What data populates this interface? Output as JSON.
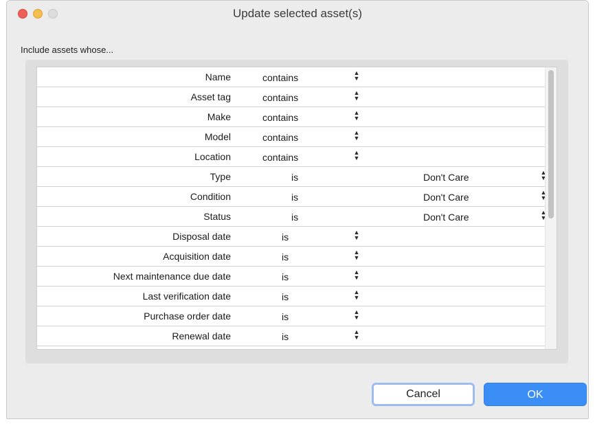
{
  "window": {
    "title": "Update selected asset(s)",
    "subtitle": "Include assets whose..."
  },
  "rows": [
    {
      "label": "Name",
      "op": "contains"
    },
    {
      "label": "Asset tag",
      "op": "contains"
    },
    {
      "label": "Make",
      "op": "contains"
    },
    {
      "label": "Model",
      "op": "contains"
    },
    {
      "label": "Location",
      "op": "contains"
    },
    {
      "label": "Type",
      "op": "is",
      "value": "Don't Care"
    },
    {
      "label": "Condition",
      "op": "is",
      "value": "Don't Care"
    },
    {
      "label": "Status",
      "op": "is",
      "value": "Don't Care"
    },
    {
      "label": "Disposal date",
      "op": "is"
    },
    {
      "label": "Acquisition date",
      "op": "is"
    },
    {
      "label": "Next maintenance due date",
      "op": "is"
    },
    {
      "label": "Last verification date",
      "op": "is"
    },
    {
      "label": "Purchase order date",
      "op": "is"
    },
    {
      "label": "Renewal date",
      "op": "is"
    }
  ],
  "buttons": {
    "cancel": "Cancel",
    "ok": "OK"
  },
  "colors": {
    "close": "#ee5f58",
    "minimize": "#f5bf4f",
    "maximize": "#dcdcdc",
    "ok_button": "#3a8ef6",
    "cancel_focus_ring": "#9cbcf0"
  }
}
